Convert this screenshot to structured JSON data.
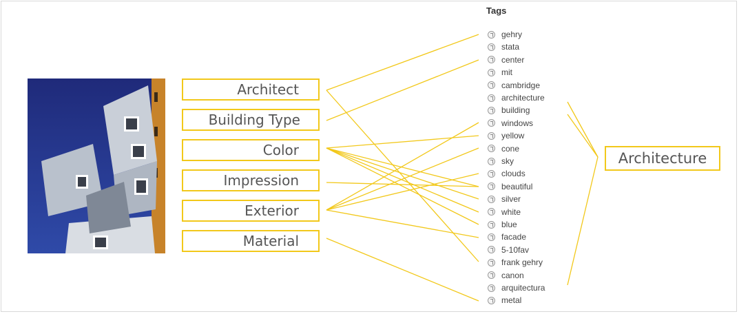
{
  "categories": [
    "Architect",
    "Building Type",
    "Color",
    "Impression",
    "Exterior",
    "Material"
  ],
  "tags_title": "Tags",
  "tags": [
    "gehry",
    "stata",
    "center",
    "mit",
    "cambridge",
    "architecture",
    "building",
    "windows",
    "yellow",
    "cone",
    "sky",
    "clouds",
    "beautiful",
    "silver",
    "white",
    "blue",
    "facade",
    "5-10fav",
    "frank gehry",
    "canon",
    "arquitectura",
    "metal"
  ],
  "result_label": "Architecture",
  "links": [
    {
      "from": "Architect",
      "to": "gehry"
    },
    {
      "from": "Architect",
      "to": "frank gehry"
    },
    {
      "from": "Building Type",
      "to": "center"
    },
    {
      "from": "Color",
      "to": "yellow"
    },
    {
      "from": "Color",
      "to": "beautiful"
    },
    {
      "from": "Color",
      "to": "silver"
    },
    {
      "from": "Color",
      "to": "white"
    },
    {
      "from": "Color",
      "to": "blue"
    },
    {
      "from": "Impression",
      "to": "beautiful"
    },
    {
      "from": "Exterior",
      "to": "windows"
    },
    {
      "from": "Exterior",
      "to": "cone"
    },
    {
      "from": "Exterior",
      "to": "clouds"
    },
    {
      "from": "Exterior",
      "to": "facade"
    },
    {
      "from": "Material",
      "to": "metal"
    }
  ],
  "grouped_tags": [
    "architecture",
    "building",
    "arquitectura"
  ],
  "colors": {
    "accent": "#f2c81a",
    "sky": "#23308a",
    "facade": "#c9cfd8",
    "frame": "#d8d8d8"
  },
  "icon": "tag-globe-icon"
}
